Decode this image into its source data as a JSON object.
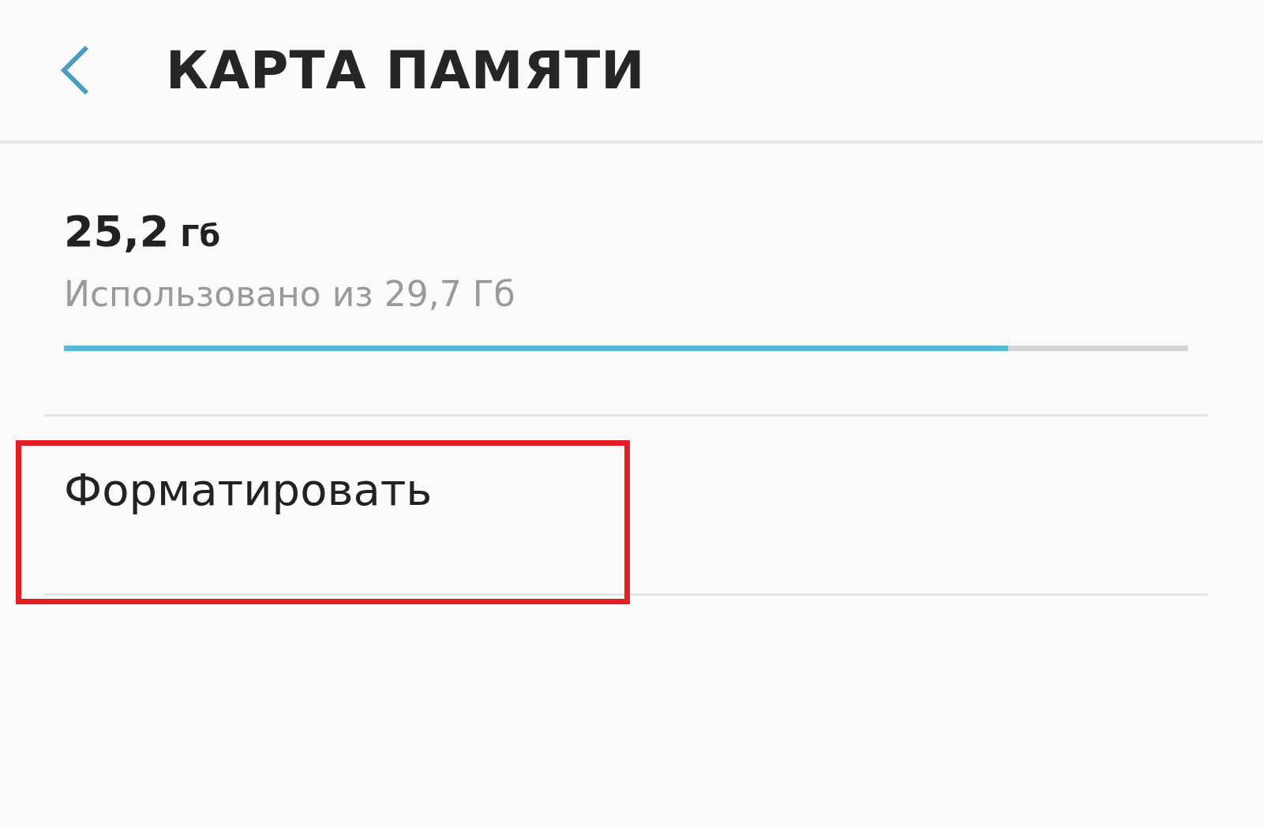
{
  "header": {
    "title": "КАРТА ПАМЯТИ"
  },
  "storage": {
    "used": "25,2",
    "unit": "Гб",
    "caption": "Использовано из 29,7 Гб",
    "level": 0.84
  },
  "actions": [
    {
      "label": "Форматировать",
      "highlighted": true
    }
  ]
}
